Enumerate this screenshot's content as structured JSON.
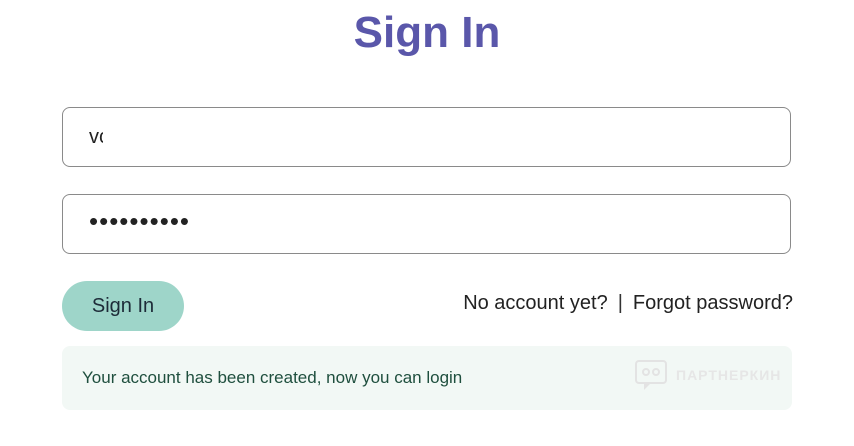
{
  "title": "Sign In",
  "form": {
    "username_value": "vc",
    "password_masked": "••••••••••"
  },
  "buttons": {
    "signin_label": "Sign In"
  },
  "links": {
    "no_account": "No account yet?",
    "separator": "|",
    "forgot_password": "Forgot password?"
  },
  "alert": {
    "message": "Your account has been created, now you can login"
  },
  "watermark": {
    "text": "ПАРТНЕРКИН"
  },
  "colors": {
    "title": "#5a57aa",
    "button": "#9ed5c9",
    "alert_bg": "#f2f8f5",
    "alert_text": "#1f4f3e"
  }
}
